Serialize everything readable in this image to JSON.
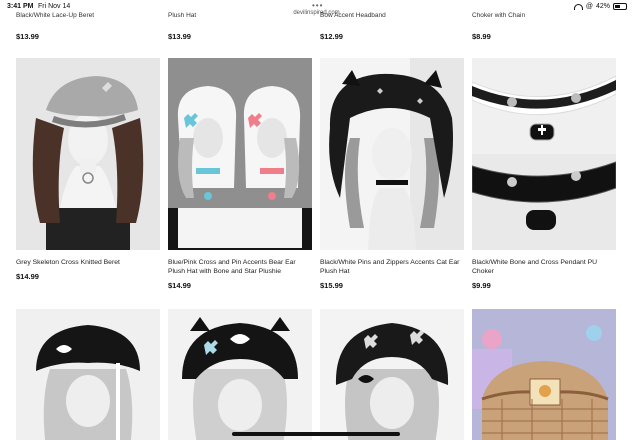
{
  "status": {
    "time": "3:41 PM",
    "date": "Fri Nov 14",
    "url": "devilinspired.com",
    "battery": "42%"
  },
  "partial_row": [
    {
      "name": "Black/White Lace-Up Beret",
      "price": "$13.99"
    },
    {
      "name": "Plush Hat",
      "price": "$13.99"
    },
    {
      "name": "Bow Accent Headband",
      "price": "$12.99"
    },
    {
      "name": "Choker with Chain",
      "price": "$8.99"
    }
  ],
  "products": [
    {
      "name": "Grey Skeleton Cross Knitted Beret",
      "price": "$14.99"
    },
    {
      "name": "Blue/Pink Cross and Pin Accents Bear Ear Plush Hat with Bone and Star Plushie",
      "price": "$14.99"
    },
    {
      "name": "Black/White Pins and Zippers Accents Cat Ear Plush Hat",
      "price": "$15.99"
    },
    {
      "name": "Black/White Bone and Cross Pendant PU Choker",
      "price": "$9.99"
    }
  ],
  "colors": {
    "background": "#ffffff",
    "text": "#111111"
  }
}
